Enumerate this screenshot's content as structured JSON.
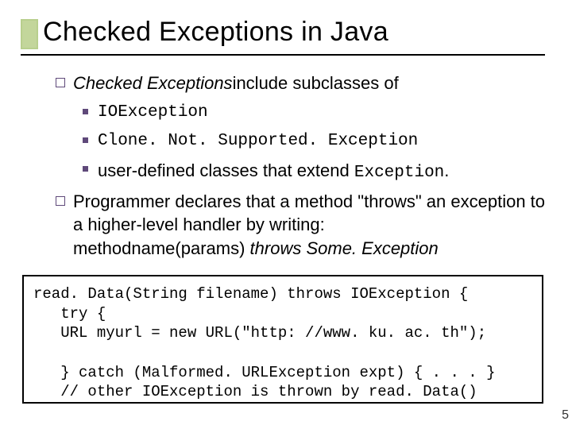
{
  "title": "Checked Exceptions in Java",
  "b1": {
    "lead": "Checked Exceptions",
    "rest": " include subclasses of"
  },
  "sub1": "IOException",
  "sub2": "Clone. Not. Supported. Exception",
  "sub3": {
    "lead": "user-defined classes that extend ",
    "code": "Exception",
    "tail": "."
  },
  "b2": {
    "l1": "Programmer declares that a method \"throws\" an exception to a higher-level handler by writing:",
    "l2a": "methodname(params) ",
    "l2b": "throws Some. Exception"
  },
  "code": "read. Data(String filename) throws IOException {\n   try {\n   URL myurl = new URL(\"http: //www. ku. ac. th\");\n\n   } catch (Malformed. URLException expt) { . . . }\n   // other IOException is thrown by read. Data()",
  "pagenum": "5"
}
